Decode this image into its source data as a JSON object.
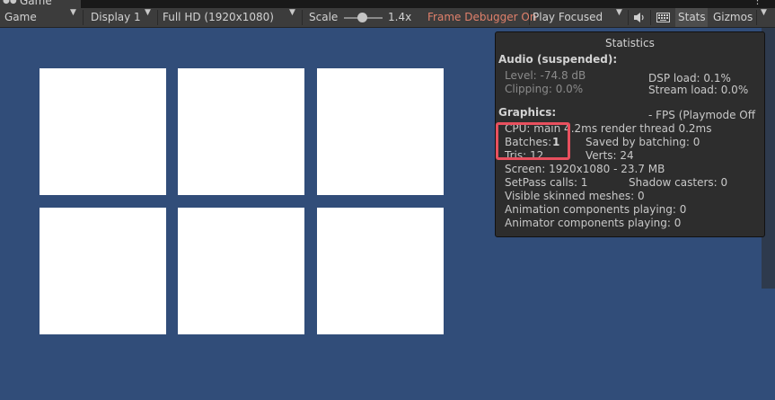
{
  "tab": {
    "icon": "gamepad-icon",
    "label": "Game"
  },
  "toolbar": {
    "view_mode": "Game",
    "display": "Display 1",
    "resolution": "Full HD (1920x1080)",
    "scale_label": "Scale",
    "scale_value": "1.4x",
    "frame_debugger": "Frame Debugger On",
    "play_mode": "Play Focused",
    "stats_label": "Stats",
    "gizmos_label": "Gizmos",
    "icons": [
      "audio-icon",
      "keyboard-icon"
    ]
  },
  "statistics": {
    "title": "Statistics",
    "audio": {
      "header": "Audio (suspended):",
      "level": "Level: -74.8 dB",
      "clipping": "Clipping: 0.0%",
      "dsp_load": "DSP load: 0.1%",
      "stream_load": "Stream load: 0.0%"
    },
    "graphics": {
      "header": "Graphics:",
      "fps": "- FPS (Playmode Off",
      "cpu": "CPU: main 4.2ms  render thread 0.2ms",
      "batches_label": "Batches:",
      "batches_value": "1",
      "saved_by_batching": "Saved by batching: 0",
      "tris": "Tris: 12",
      "verts": "Verts: 24",
      "screen": "Screen: 1920x1080 - 23.7 MB",
      "setpass": "SetPass calls: 1",
      "shadow_casters": "Shadow casters: 0",
      "skinned_meshes": "Visible skinned meshes: 0",
      "animation_components": "Animation components playing: 0",
      "animator_components": "Animator components playing: 0"
    }
  },
  "colors": {
    "game_background": "#314d79",
    "highlight": "#e8505e",
    "frame_debugger_text": "#e0806b"
  }
}
